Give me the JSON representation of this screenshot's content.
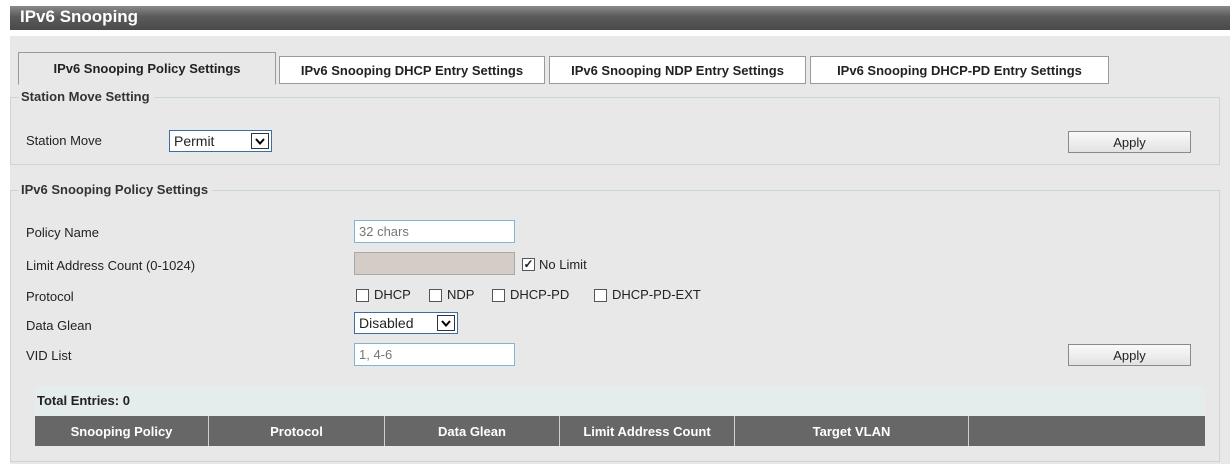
{
  "title": "IPv6 Snooping",
  "tabs": [
    {
      "label": "IPv6 Snooping Policy Settings"
    },
    {
      "label": "IPv6 Snooping DHCP Entry Settings"
    },
    {
      "label": "IPv6 Snooping NDP Entry Settings"
    },
    {
      "label": "IPv6 Snooping DHCP-PD Entry Settings"
    }
  ],
  "station_move": {
    "legend": "Station Move Setting",
    "label": "Station Move",
    "value": "Permit",
    "apply": "Apply"
  },
  "policy": {
    "legend": "IPv6 Snooping Policy Settings",
    "policy_name_label": "Policy Name",
    "policy_name_placeholder": "32 chars",
    "limit_label": "Limit Address Count (0-1024)",
    "limit_value": "",
    "no_limit_label": "No Limit",
    "no_limit_checked": true,
    "protocol_label": "Protocol",
    "protocols": [
      {
        "label": "DHCP",
        "checked": false
      },
      {
        "label": "NDP",
        "checked": false
      },
      {
        "label": "DHCP-PD",
        "checked": false
      },
      {
        "label": "DHCP-PD-EXT",
        "checked": false
      }
    ],
    "data_glean_label": "Data Glean",
    "data_glean_value": "Disabled",
    "vid_label": "VID List",
    "vid_placeholder": "1, 4-6",
    "apply": "Apply"
  },
  "table": {
    "total": "Total Entries: 0",
    "columns": [
      "Snooping Policy",
      "Protocol",
      "Data Glean",
      "Limit Address Count",
      "Target VLAN",
      ""
    ]
  },
  "colors": {
    "header_bg": "#676767",
    "panel_bg": "#e8e8e8",
    "input_border": "#7fb6d8"
  }
}
